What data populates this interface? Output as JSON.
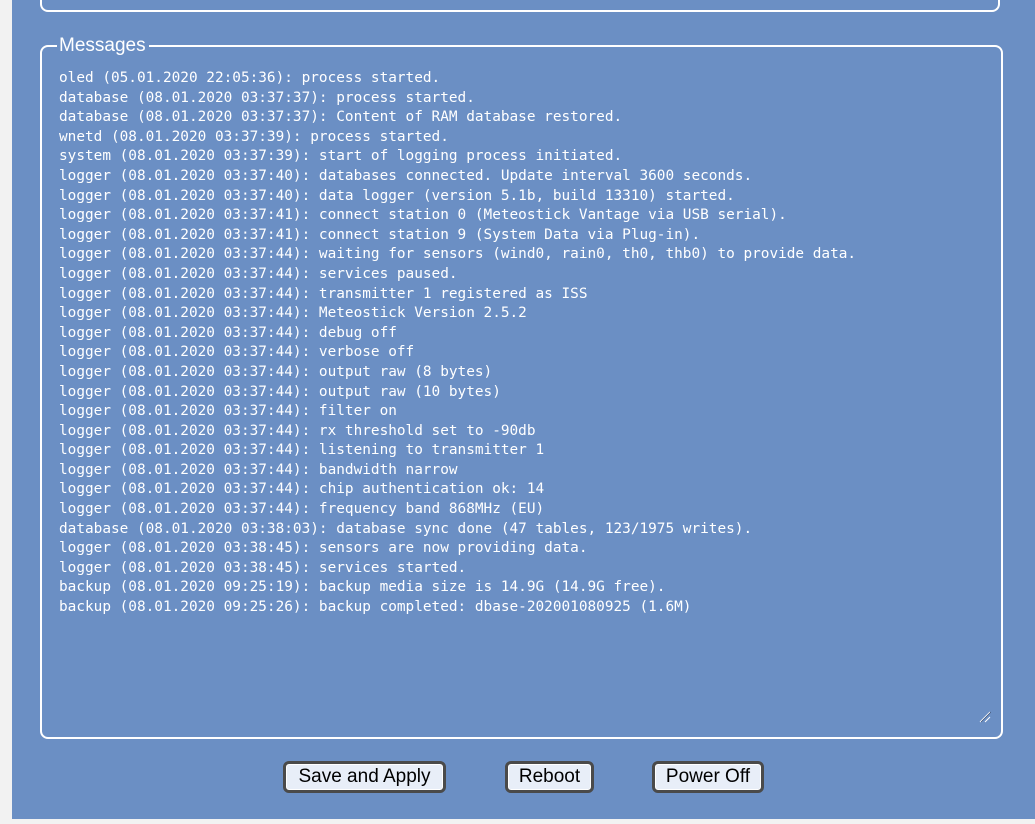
{
  "messages": {
    "legend": "Messages",
    "lines": [
      "oled (05.01.2020 22:05:36): process started.",
      "database (08.01.2020 03:37:37): process started.",
      "database (08.01.2020 03:37:37): Content of RAM database restored.",
      "wnetd (08.01.2020 03:37:39): process started.",
      "system (08.01.2020 03:37:39): start of logging process initiated.",
      "logger (08.01.2020 03:37:40): databases connected. Update interval 3600 seconds.",
      "logger (08.01.2020 03:37:40): data logger (version 5.1b, build 13310) started.",
      "logger (08.01.2020 03:37:41): connect station 0 (Meteostick Vantage via USB serial).",
      "logger (08.01.2020 03:37:41): connect station 9 (System Data via Plug-in).",
      "logger (08.01.2020 03:37:44): waiting for sensors (wind0, rain0, th0, thb0) to provide data.",
      "logger (08.01.2020 03:37:44): services paused.",
      "logger (08.01.2020 03:37:44): transmitter 1 registered as ISS",
      "logger (08.01.2020 03:37:44): Meteostick Version 2.5.2",
      "logger (08.01.2020 03:37:44): debug off",
      "logger (08.01.2020 03:37:44): verbose off",
      "logger (08.01.2020 03:37:44): output raw (8 bytes)",
      "logger (08.01.2020 03:37:44): output raw (10 bytes)",
      "logger (08.01.2020 03:37:44): filter on",
      "logger (08.01.2020 03:37:44): rx threshold set to -90db",
      "logger (08.01.2020 03:37:44): listening to transmitter 1",
      "logger (08.01.2020 03:37:44): bandwidth narrow",
      "logger (08.01.2020 03:37:44): chip authentication ok: 14",
      "logger (08.01.2020 03:37:44): frequency band 868MHz (EU)",
      "database (08.01.2020 03:38:03): database sync done (47 tables, 123/1975 writes).",
      "logger (08.01.2020 03:38:45): sensors are now providing data.",
      "logger (08.01.2020 03:38:45): services started.",
      "backup (08.01.2020 09:25:19): backup media size is 14.9G (14.9G free).",
      "backup (08.01.2020 09:25:26): backup completed: dbase-202001080925 (1.6M)"
    ]
  },
  "buttons": {
    "save_label": "Save and Apply",
    "reboot_label": "Reboot",
    "poweroff_label": "Power Off"
  },
  "colors": {
    "page_background": "#6b8fc4",
    "text": "#ffffff",
    "button_background": "#e8eef8"
  }
}
